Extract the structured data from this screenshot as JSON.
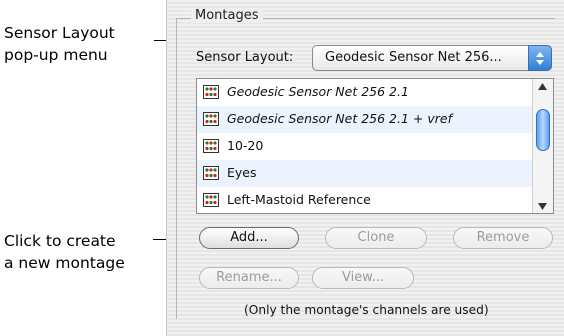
{
  "callouts": {
    "sensor_layout_line1": "Sensor Layout",
    "sensor_layout_line2": "pop-up menu",
    "create_line1": "Click to create",
    "create_line2": "a new montage"
  },
  "group": {
    "title": "Montages"
  },
  "sensor_layout": {
    "label": "Sensor Layout:",
    "selected": "Geodesic Sensor Net 256..."
  },
  "montages": [
    {
      "label": "Geodesic Sensor Net 256 2.1",
      "italic": true
    },
    {
      "label": "Geodesic Sensor Net 256 2.1 + vref",
      "italic": true
    },
    {
      "label": "10-20",
      "italic": false
    },
    {
      "label": "Eyes",
      "italic": false
    },
    {
      "label": "Left-Mastoid Reference",
      "italic": false
    }
  ],
  "buttons": {
    "add": "Add...",
    "clone": "Clone",
    "remove": "Remove",
    "rename": "Rename...",
    "view": "View..."
  },
  "note": "(Only the montage's channels are used)",
  "colors": {
    "accent": "#2f7fd6",
    "row_alt": "#edf3fe",
    "disabled_text": "#9b9b9b"
  }
}
